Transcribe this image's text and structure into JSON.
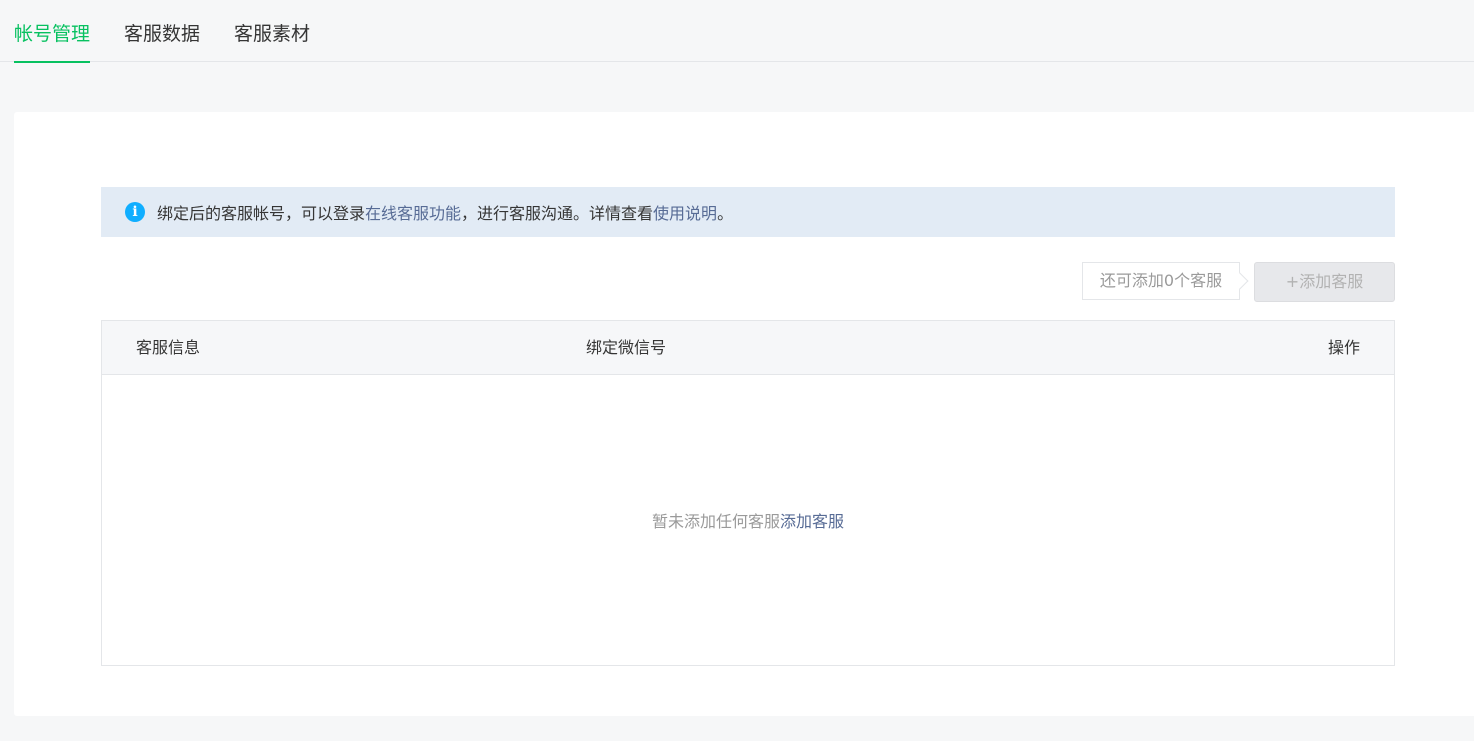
{
  "tabs": [
    {
      "label": "帐号管理",
      "active": true
    },
    {
      "label": "客服数据",
      "active": false
    },
    {
      "label": "客服素材",
      "active": false
    }
  ],
  "notice": {
    "icon": "info-icon",
    "text_before": "绑定后的客服帐号，可以登录",
    "link1": "在线客服功能",
    "text_middle": "，进行客服沟通。详情查看",
    "link2": "使用说明",
    "text_after": "。"
  },
  "toolbar": {
    "quota_text": "还可添加0个客服",
    "add_button_label": "+添加客服"
  },
  "table": {
    "columns": [
      "客服信息",
      "绑定微信号",
      "操作"
    ],
    "empty_text": "暂未添加任何客服",
    "empty_link": "添加客服"
  },
  "colors": {
    "accent": "#07c160",
    "link": "#576b95",
    "notice_bg": "#e2ebf5",
    "info_icon": "#10aeff"
  }
}
